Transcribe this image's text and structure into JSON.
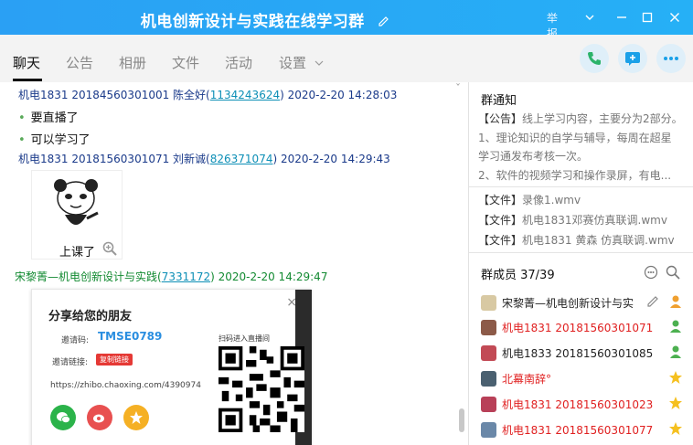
{
  "window": {
    "title": "机电创新设计与实践在线学习群",
    "report_label": "举报"
  },
  "tabs": [
    "聊天",
    "公告",
    "相册",
    "文件",
    "活动",
    "设置"
  ],
  "messages": [
    {
      "sender_prefix": "机电1831 20184560301001 陈全好(",
      "sender_id": "1134243624",
      "time": ") 2020-2-20 14:28:03",
      "lines": [
        "要直播了",
        "可以学习了"
      ]
    },
    {
      "sender_prefix": "机电1831  20181560301071 刘新诚(",
      "sender_id": "826371074",
      "time": ") 2020-2-20 14:29:43",
      "sticker_caption": "上课了"
    },
    {
      "sender_prefix": "宋黎菁—机电创新设计与实践(",
      "sender_id": "7331172",
      "time": ") 2020-2-20 14:29:47"
    }
  ],
  "share_card": {
    "title": "分享给您的朋友",
    "invite_code_label": "邀请码:",
    "invite_code": "TMSE0789",
    "invite_link_label": "邀请链接:",
    "copy_link_label": "复制链接",
    "url": "https://zhibo.chaoxing.com/4390974",
    "qr_label": "扫码进入直播间"
  },
  "notice": {
    "title": "群通知",
    "items": [
      {
        "tag": "【公告】",
        "text": "线上学习内容，主要分为2部分。"
      },
      {
        "tag": "",
        "text": "1、理论知识的自学与辅导，每周在超星"
      },
      {
        "tag": "",
        "text": "学习通发布考核一次。"
      },
      {
        "tag": "",
        "text": "2、软件的视频学习和操作录屏，有电..."
      },
      {
        "tag": "【文件】",
        "text": "录像1.wmv"
      },
      {
        "tag": "【文件】",
        "text": "机电1831邓赛仿真联调.wmv"
      },
      {
        "tag": "【文件】",
        "text": "机电1831 黄森 仿真联调.wmv"
      }
    ]
  },
  "members": {
    "title": "群成员 37/39",
    "list": [
      {
        "name": "宋黎菁—机电创新设计与实",
        "color": "dark",
        "badge": "owner"
      },
      {
        "name": "机电1831  20181560301071",
        "color": "red",
        "badge": "admin"
      },
      {
        "name": "机电1833  20181560301085",
        "color": "dark",
        "badge": "admin"
      },
      {
        "name": "北幕南辞°",
        "color": "red",
        "badge": "star"
      },
      {
        "name": "机电1831  20181560301023",
        "color": "red",
        "badge": "star"
      },
      {
        "name": "机电1831  20181560301077",
        "color": "red",
        "badge": "star"
      }
    ]
  },
  "colors": {
    "titlebar": "#2aa0f4",
    "accent": "#1aa0e8",
    "member_red": "#e02020",
    "share_red": "#e53935"
  }
}
